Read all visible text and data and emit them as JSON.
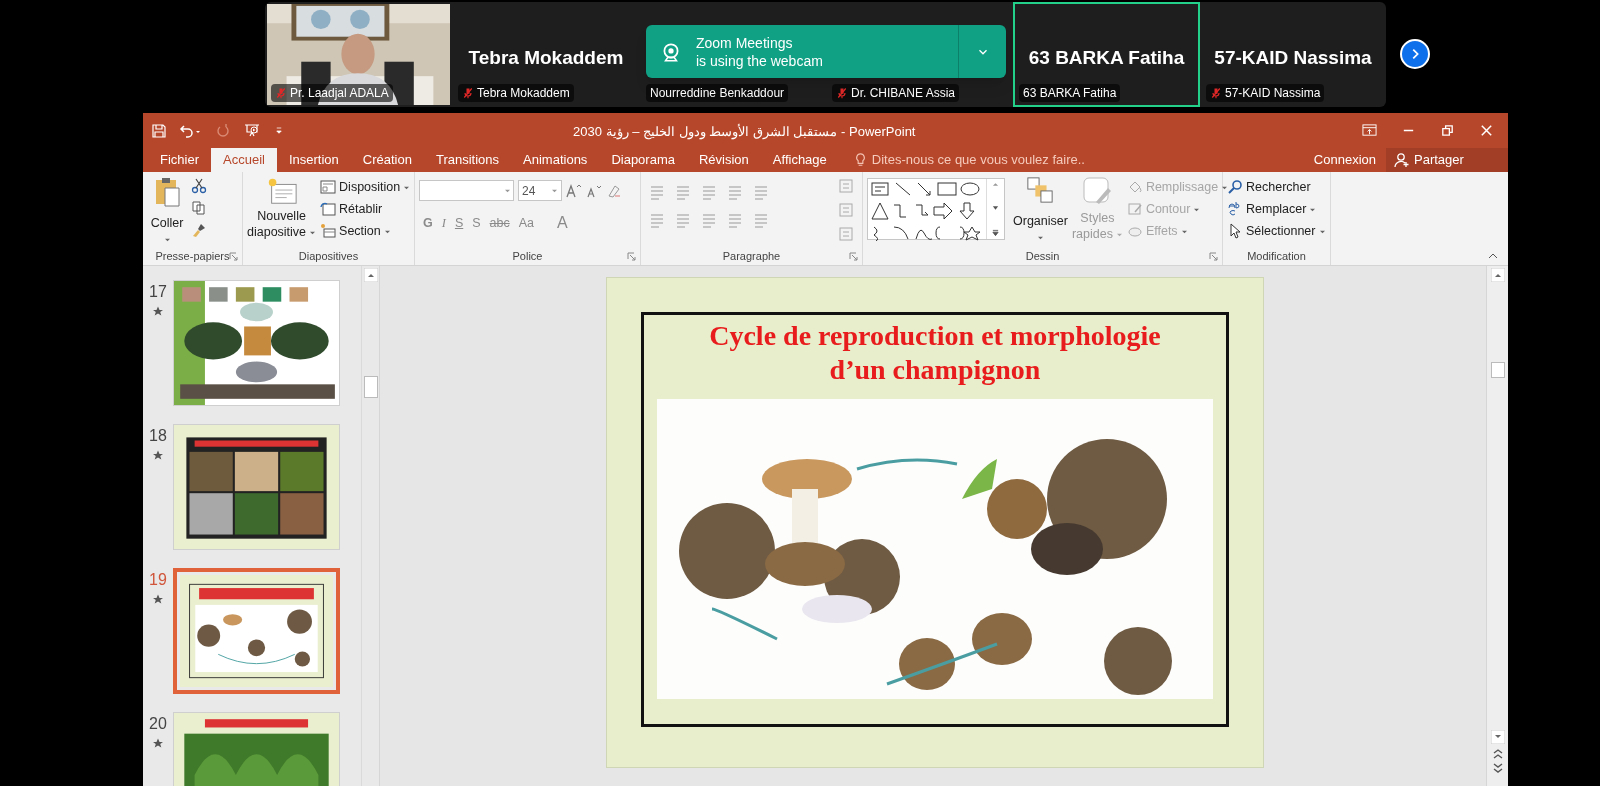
{
  "meeting": {
    "participants": [
      {
        "kind": "video",
        "label": "Pr. Laadjal ADALA",
        "muted": true,
        "selected": false
      },
      {
        "kind": "name",
        "display_name": "Tebra Mokaddem",
        "label": "Tebra Mokaddem",
        "muted": true,
        "selected": false
      },
      {
        "kind": "name",
        "label": "Nourreddine Benkaddour",
        "muted": false,
        "selected": false
      },
      {
        "kind": "name",
        "label": "Dr. CHIBANE Assia",
        "muted": true,
        "selected": false
      },
      {
        "kind": "name",
        "display_name": "63 BARKA Fatiha",
        "label": "63 BARKA Fatiha",
        "muted": false,
        "selected": true
      },
      {
        "kind": "name",
        "display_name": "57-KAID Nassima",
        "label": "57-KAID Nassima",
        "muted": true,
        "selected": false
      }
    ],
    "notification": {
      "title": "Zoom Meetings",
      "message": "is using the webcam"
    }
  },
  "window": {
    "title": "مستقبل الشرق الأوسط ودول الخليج – رؤية 2030 - PowerPoint"
  },
  "tabs": [
    {
      "label": "Fichier",
      "selected": false
    },
    {
      "label": "Accueil",
      "selected": true
    },
    {
      "label": "Insertion",
      "selected": false
    },
    {
      "label": "Création",
      "selected": false
    },
    {
      "label": "Transitions",
      "selected": false
    },
    {
      "label": "Animations",
      "selected": false
    },
    {
      "label": "Diaporama",
      "selected": false
    },
    {
      "label": "Révision",
      "selected": false
    },
    {
      "label": "Affichage",
      "selected": false
    }
  ],
  "tell_me": {
    "placeholder": "Dites-nous ce que vous voulez faire.."
  },
  "account": {
    "sign_in": "Connexion",
    "share": "Partager"
  },
  "ribbon": {
    "clipboard": {
      "label": "Presse-papiers",
      "paste": "Coller"
    },
    "slides": {
      "label": "Diapositives",
      "new_slide": [
        "Nouvelle",
        "diapositive"
      ],
      "items": [
        "Disposition",
        "Rétablir",
        "Section"
      ]
    },
    "font": {
      "label": "Police",
      "size": "24",
      "buttons": [
        "G",
        "I",
        "S",
        "S",
        "abc",
        "Aa",
        "A"
      ]
    },
    "paragraph": {
      "label": "Paragraphe"
    },
    "drawing": {
      "label": "Dessin",
      "arrange": "Organiser",
      "quick_styles": [
        "Styles",
        "rapides"
      ],
      "quick_styles_disabled": true,
      "tools": [
        {
          "label": "Remplissage",
          "disabled": true
        },
        {
          "label": "Contour",
          "disabled": true
        },
        {
          "label": "Effets",
          "disabled": true
        }
      ]
    },
    "editing": {
      "label": "Modification",
      "items": [
        "Rechercher",
        "Remplacer",
        "Sélectionner"
      ]
    }
  },
  "thumbnails": [
    {
      "number": "17",
      "selected": false
    },
    {
      "number": "18",
      "selected": false
    },
    {
      "number": "19",
      "selected": true
    },
    {
      "number": "20",
      "selected": false
    }
  ],
  "slide": {
    "title": [
      "Cycle de reproduction et morphologie",
      "d’un champignon"
    ]
  }
}
